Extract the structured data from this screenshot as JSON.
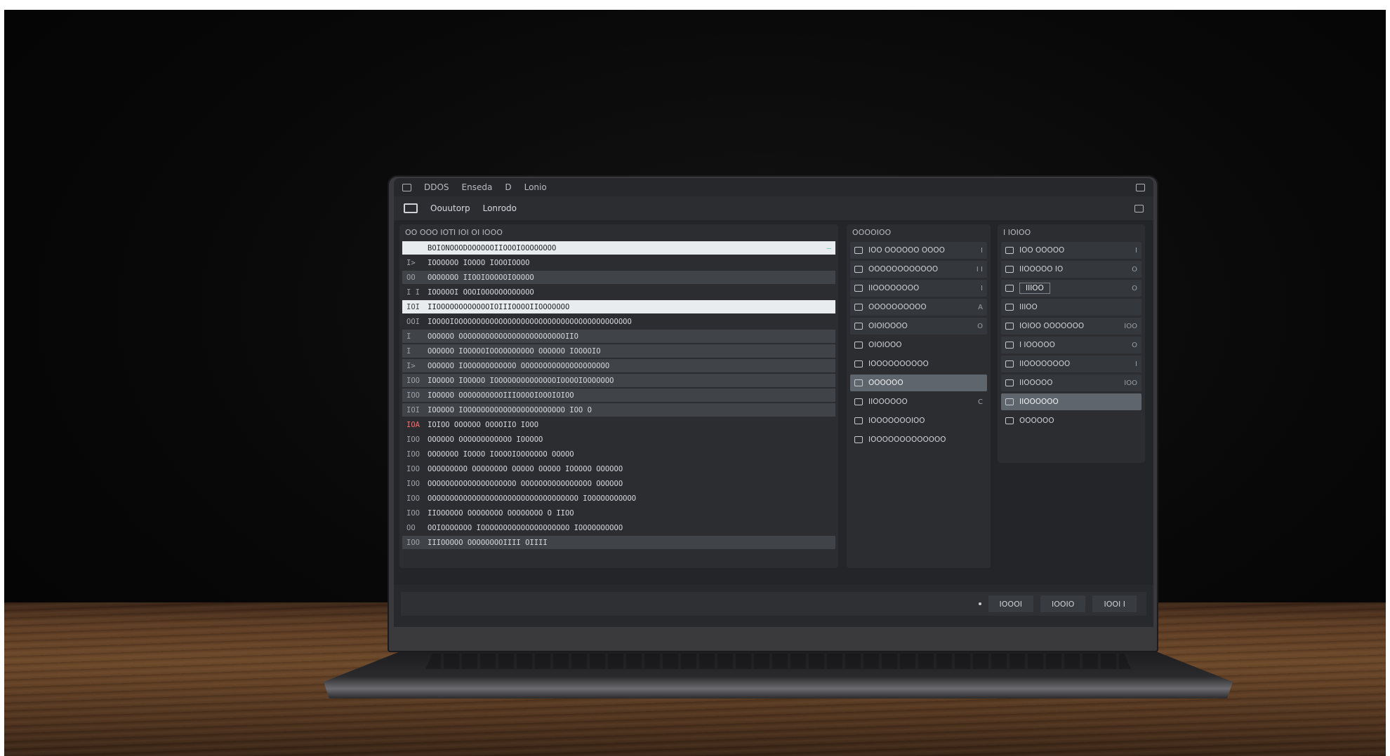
{
  "window": {
    "menu": [
      "DDOS",
      "Enseda",
      "D",
      "Lonio"
    ],
    "toolbar": [
      "Oouutorp",
      "Lonrodo"
    ]
  },
  "left_panel": {
    "header": "OO  OOO IOTI IOI  OI IOOO",
    "rows": [
      {
        "id": "",
        "text": "BOIONOOODOOOOOOIIOOOIOOOOOOOO",
        "style": "active",
        "trail": "–"
      },
      {
        "id": "I>",
        "text": "IOOOOOO IOOOO IOOOIOOOO",
        "style": "plain"
      },
      {
        "id": "OO",
        "text": "OOOOOOO IIOOIOOOOOIOOOOO",
        "style": "shade"
      },
      {
        "id": "I I",
        "text": "IOOOOOI  OOOIOOOOOOOOOOOO",
        "style": "plain"
      },
      {
        "id": "IOI",
        "text": "IIOOOOOOOOOOOOIOIIIOOOOIIOOOOOOO",
        "style": "active"
      },
      {
        "id": "OOI",
        "text": "IOOOOIOOOOOOOOOOOOOOOOOOOOOOOOOOOOOOOOOOOOOOOO",
        "style": "plain"
      },
      {
        "id": "I",
        "text": "OOOOOO OOOOOOOOOOOOOOOOOOOOOOOOIIO",
        "style": "shade"
      },
      {
        "id": "I",
        "text": "OOOOOO IOOOOOIOOOOOOOOOO OOOOOO IOOOOIO",
        "style": "shade"
      },
      {
        "id": "I>",
        "text": "OOOOOO IOOOOOOOOOOOO OOOOOOOOOOOOOOOOOOOO",
        "style": "shade"
      },
      {
        "id": "IOO",
        "text": "IOOOOO IOOOOO IOOOOOOOOOOOOOOIOOOOIOOOOOOO",
        "style": "shade"
      },
      {
        "id": "IOO",
        "text": "IOOOOO  OOOOOOOOOOIIIOOOOIOOOIOIOO",
        "style": "shade"
      },
      {
        "id": "IOI",
        "text": "IOOOOO IOOOOOOOOOOOOOOOOOOOOOOO IOO O",
        "style": "shade"
      },
      {
        "id": "IOA",
        "text": "IOIOO  OOOOOO OOOOIIO IOOO",
        "style": "red"
      },
      {
        "id": "IOO",
        "text": "OOOOOO OOOOOOOOOOOO IOOOOO",
        "style": "plain"
      },
      {
        "id": "IOO",
        "text": "OOOOOOO IOOOO IOOOOIOOOOOOO OOOOO",
        "style": "plain"
      },
      {
        "id": "IOO",
        "text": "OOOOOOOOO OOOOOOOO OOOOO OOOOO IOOOOO OOOOOO",
        "style": "plain"
      },
      {
        "id": "IOO",
        "text": "OOOOOOOOOOOOOOOOOOOO OOOOOOOOOOOOOOOO OOOOOO",
        "style": "plain"
      },
      {
        "id": "IOO",
        "text": "OOOOOOOOOOOOOOOOOOOOOOOOOOOOOOOOOO IOOOOOOOOOOO",
        "style": "plain"
      },
      {
        "id": "IOO",
        "text": "IIOOOOOO OOOOOOOO OOOOOOOO O IIOO",
        "style": "plain"
      },
      {
        "id": "OO",
        "text": "OOIOOOOOOO  IOOOOOOOOOOOOOOOOOOOO IOOOOOOOOOO",
        "style": "plain"
      },
      {
        "id": "IOO",
        "text": "IIIOOOOO OOOOOOOOIIII OIIII",
        "style": "shade"
      }
    ]
  },
  "mid_panel": {
    "header": "OOOOIOO",
    "rows": [
      {
        "text": "IOO OOOOOO OOOO",
        "trail": "I",
        "style": "box"
      },
      {
        "text": "OOOOOOOOOOOO",
        "trail": "I  I",
        "style": "box"
      },
      {
        "text": "IIOOOOOOOO",
        "trail": "I",
        "style": "box"
      },
      {
        "text": "OOOOOOOOOO",
        "trail": "A",
        "style": "box"
      },
      {
        "text": "OIOIOOOO",
        "trail": "O",
        "style": "box"
      },
      {
        "text": "OIOIOOO",
        "trail": "",
        "style": "plain"
      },
      {
        "text": "IOOOOOOOOOO",
        "trail": "",
        "style": "plain"
      },
      {
        "text": "OOOOOO",
        "trail": "",
        "style": "sel"
      },
      {
        "text": "IIOOOOOO",
        "trail": "C",
        "style": "plain"
      },
      {
        "text": "IOOOOOOOIOO",
        "trail": "",
        "style": "plain"
      },
      {
        "text": "IOOOOOOOOOOOOO",
        "trail": "",
        "style": "plain"
      }
    ]
  },
  "right_panel": {
    "header": "I IOIOO",
    "rows": [
      {
        "text": "IOO OOOOO",
        "trail": "I",
        "style": "box"
      },
      {
        "text": "IIOOOOO IO",
        "trail": "O",
        "style": "box"
      },
      {
        "text": "IIIOO",
        "trail": "O",
        "style": "input"
      },
      {
        "text": "IIIOO",
        "trail": "",
        "style": "box"
      },
      {
        "text": "IOIOO OOOOOOO",
        "trail": "IOO",
        "style": "box"
      },
      {
        "text": "I IOOOOO",
        "trail": "O",
        "style": "box"
      },
      {
        "text": "IIOOOOOOOO",
        "trail": "I",
        "style": "box"
      },
      {
        "text": "IIOOOOO",
        "trail": "IOO",
        "style": "box"
      },
      {
        "text": "IIOOOOOO",
        "trail": "",
        "style": "sel"
      },
      {
        "text": "OOOOOO",
        "trail": "",
        "style": "plain"
      }
    ]
  },
  "footer": {
    "buttons": [
      "IOOOI",
      "IOOIO",
      "IOOI I"
    ]
  }
}
